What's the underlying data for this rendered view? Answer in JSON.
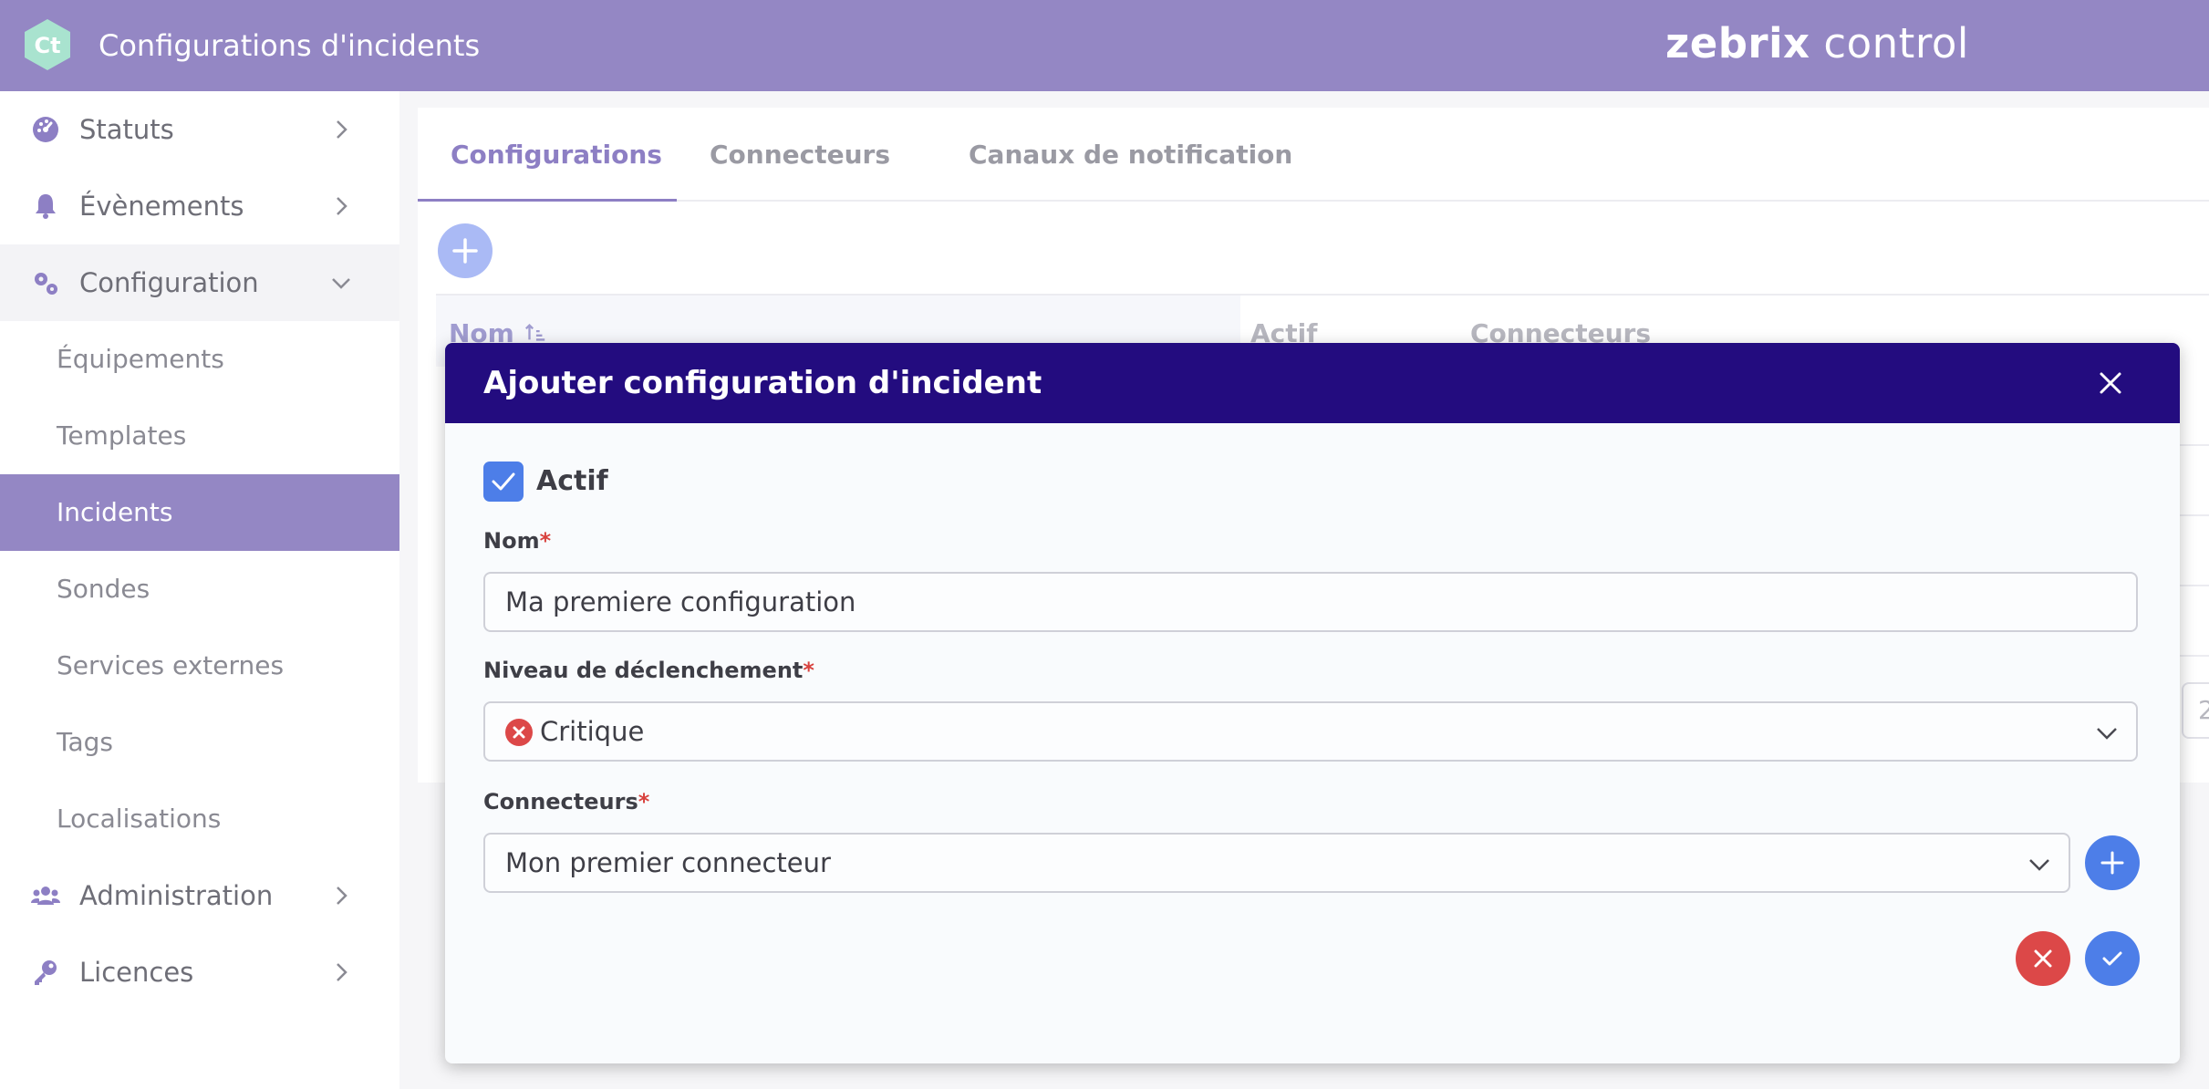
{
  "header": {
    "logo_text": "Ct",
    "title": "Configurations d'incidents",
    "brand_bold": "zebrix",
    "brand_light": "control"
  },
  "sidebar": {
    "items": [
      {
        "label": "Statuts",
        "icon": "gauge-icon"
      },
      {
        "label": "Évènements",
        "icon": "bell-icon"
      },
      {
        "label": "Configuration",
        "icon": "gears-icon",
        "expanded": true
      },
      {
        "label": "Administration",
        "icon": "users-icon"
      },
      {
        "label": "Licences",
        "icon": "key-icon"
      }
    ],
    "configuration_children": [
      {
        "label": "Équipements"
      },
      {
        "label": "Templates"
      },
      {
        "label": "Incidents",
        "active": true
      },
      {
        "label": "Sondes"
      },
      {
        "label": "Services externes"
      },
      {
        "label": "Tags"
      },
      {
        "label": "Localisations"
      }
    ]
  },
  "main": {
    "tabs": [
      {
        "label": "Configurations",
        "active": true
      },
      {
        "label": "Connecteurs"
      },
      {
        "label": "Canaux de notification"
      }
    ],
    "table_headers": {
      "name": "Nom",
      "active": "Actif",
      "connectors": "Connecteurs"
    },
    "pager_partial": "2"
  },
  "modal": {
    "title": "Ajouter configuration d'incident",
    "active_checkbox": {
      "label": "Actif",
      "checked": true
    },
    "name_field": {
      "label": "Nom",
      "required_mark": "*",
      "value": "Ma premiere configuration"
    },
    "level_field": {
      "label": "Niveau de déclenchement",
      "required_mark": "*",
      "value": "Critique",
      "icon": "critical-x-icon"
    },
    "connectors_field": {
      "label": "Connecteurs",
      "required_mark": "*",
      "value": "Mon premier connecteur"
    }
  },
  "colors": {
    "header": "#9487c4",
    "modal_header": "#230c7f",
    "primary_blue": "#4d7ee8",
    "danger_red": "#dc4848",
    "active_nav": "#9487c4"
  }
}
